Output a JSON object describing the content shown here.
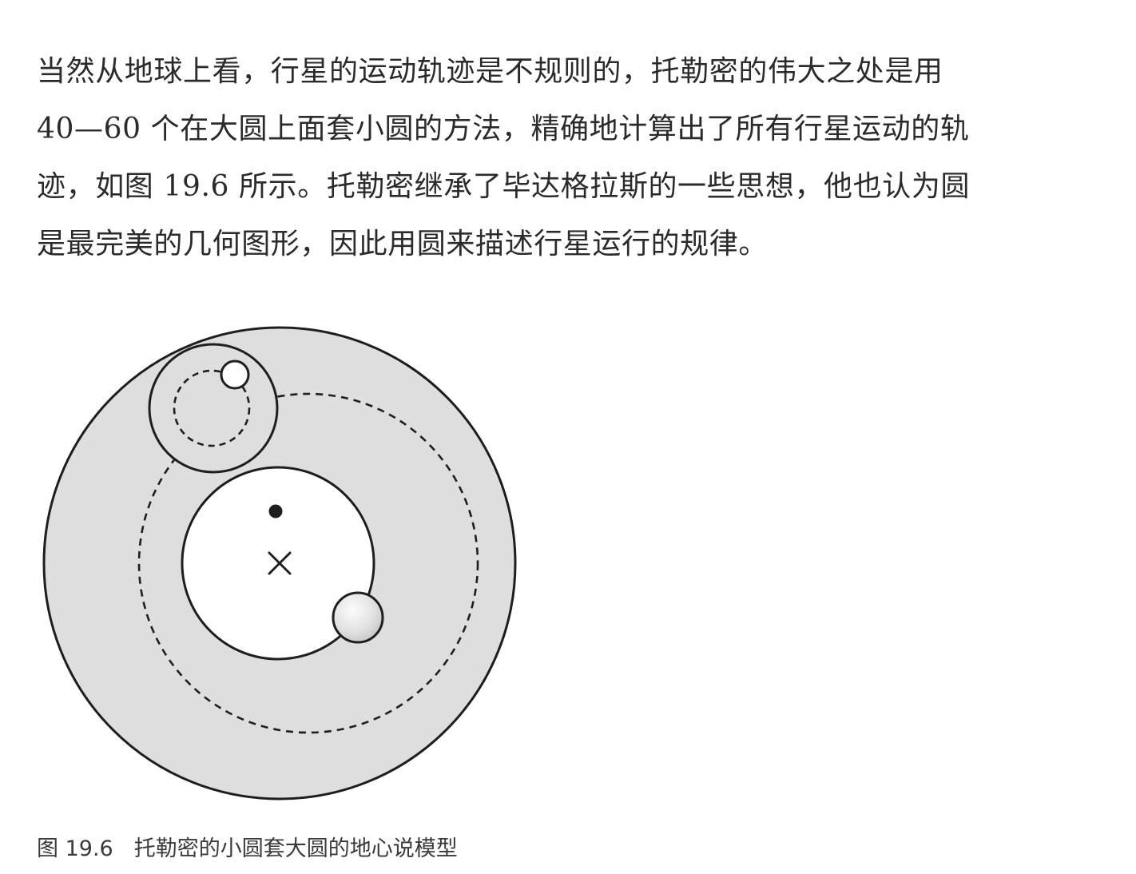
{
  "paragraph": {
    "lines": [
      "当然从地球上看，行星的运动轨迹是不规则的，托勒密的伟大之处是用",
      "40—60 个在大圆上面套小圆的方法，精确地计算出了所有行星运动的轨",
      "迹，如图 19.6 所示。托勒密继承了毕达格拉斯的一些思想，他也认为圆",
      "是最完美的几何图形，因此用圆来描述行星运行的规律。"
    ]
  },
  "figure": {
    "caption_number": "图 19.6",
    "caption_text": "托勒密的小圆套大圆的地心说模型",
    "colors": {
      "outer_disk": "#dedede",
      "stroke": "#1e1e1e",
      "inner_disk": "#ffffff",
      "earth_highlight": "#f4f4f4",
      "earth_shade": "#c9c9c9"
    }
  }
}
